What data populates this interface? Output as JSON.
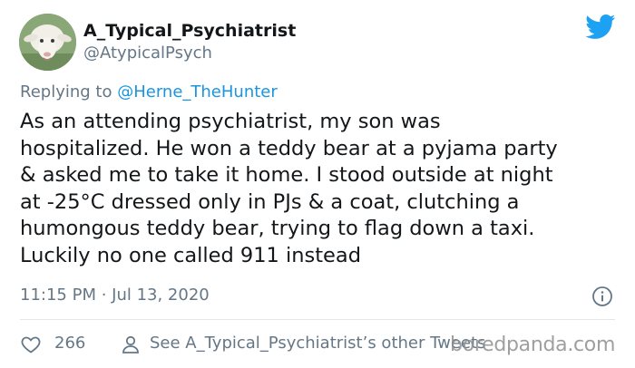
{
  "author": {
    "name": "A_Typical_Psychiatrist",
    "handle": "@AtypicalPsych",
    "avatar": "sheep-avatar"
  },
  "reply": {
    "prefix": "Replying to",
    "to": "@Herne_TheHunter"
  },
  "tweet": {
    "lines": [
      "As an attending psychiatrist, my son was",
      "hospitalized. He won a teddy bear at a pyjama party",
      "& asked me to take it home. I stood outside at night",
      "at -25°C dressed only in PJs & a coat, clutching a",
      "humongous teddy bear, trying to flag down a taxi.",
      "Luckily no one called 911 instead"
    ]
  },
  "meta": {
    "timestamp": "11:15 PM · Jul 13, 2020"
  },
  "actions": {
    "likes": "266",
    "other_tweets": "See A_Typical_Psychiatrist’s other Tweets"
  },
  "watermark": "boredpanda.com",
  "icons": {
    "brand": "twitter-bird-icon",
    "info": "info-icon",
    "like": "heart-icon",
    "profile": "person-icon"
  },
  "colors": {
    "brand": "#1da1f2",
    "link": "#1b95e0",
    "text": "#14171a",
    "muted": "#657786",
    "divider": "#e1e8ed"
  }
}
